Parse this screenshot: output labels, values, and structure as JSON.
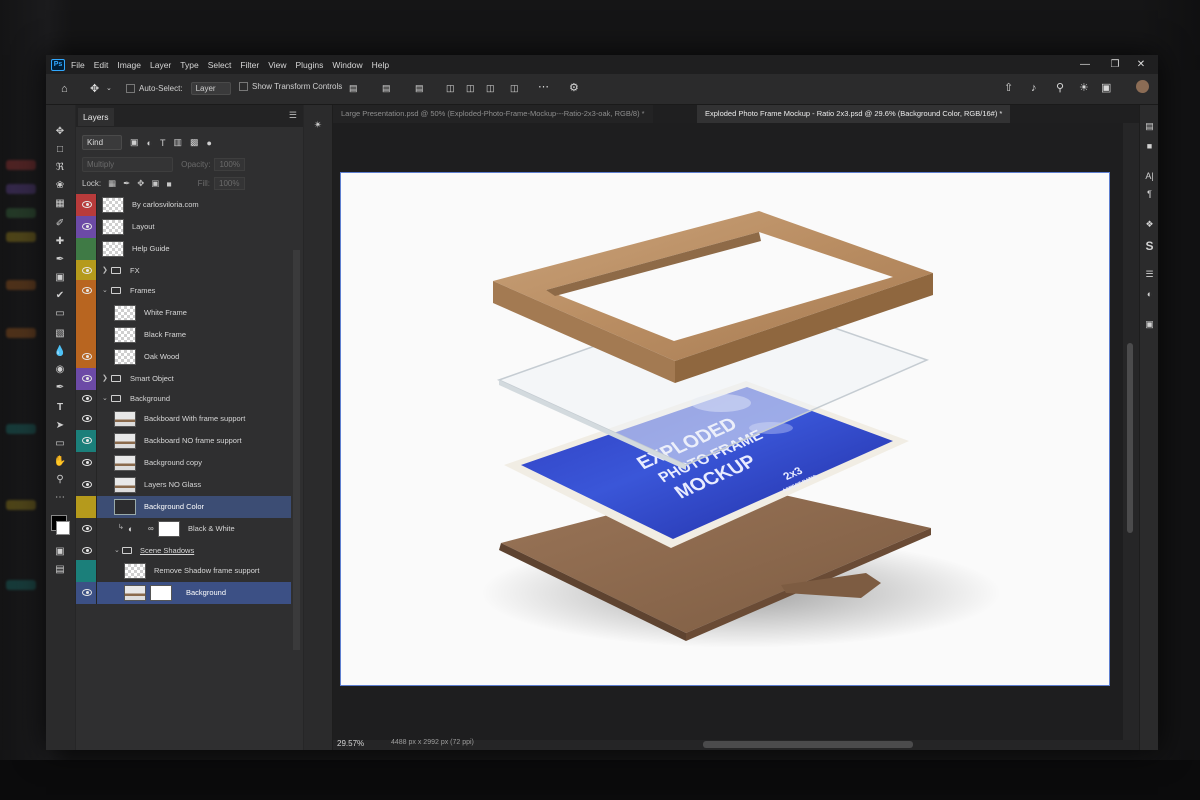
{
  "menu": [
    "File",
    "Edit",
    "Image",
    "Layer",
    "Type",
    "Select",
    "Filter",
    "View",
    "Plugins",
    "Window",
    "Help"
  ],
  "options": {
    "auto_select_label": "Auto-Select:",
    "auto_select_value": "Layer",
    "transform_label": "Show Transform Controls"
  },
  "layers_panel": {
    "tab_label": "Layers",
    "filter_kind": "Kind",
    "blend_mode": "Multiply",
    "opacity_label": "Opacity:",
    "opacity_value": "100%",
    "lock_label": "Lock:",
    "fill_label": "Fill:",
    "fill_value": "100%",
    "layers": [
      {
        "name": "By carlosviloria.com",
        "color": "#b83b3b",
        "visible": true
      },
      {
        "name": "Layout",
        "color": "#6c4aa6",
        "visible": true
      },
      {
        "name": "Help Guide",
        "color": "#3f7a45",
        "visible": false
      },
      {
        "name": "FX",
        "color": "#b59a1c",
        "visible": true
      },
      {
        "name": "Frames",
        "color": "#b86520",
        "visible": true
      },
      {
        "name": "White Frame",
        "color": "#b86520",
        "visible": false
      },
      {
        "name": "Black Frame",
        "color": "#b86520",
        "visible": false
      },
      {
        "name": "Oak Wood",
        "color": "#b86520",
        "visible": true
      },
      {
        "name": "Smart Object",
        "color": "#6c4aa6",
        "visible": true
      },
      {
        "name": "Background",
        "color": "#2f2f30",
        "visible": true
      },
      {
        "name": "Backboard With frame support",
        "color": "#2f2f30",
        "visible": true
      },
      {
        "name": "Backboard NO frame support",
        "color": "#1b7f7a",
        "visible": true
      },
      {
        "name": "Background copy",
        "color": "#2f2f30",
        "visible": true
      },
      {
        "name": "Layers NO Glass",
        "color": "#2f2f30",
        "visible": true
      },
      {
        "name": "Background Color",
        "color": "#b59a1c",
        "visible": false
      },
      {
        "name": "Black & White",
        "color": "#2f2f30",
        "visible": true
      },
      {
        "name": "Scene Shadows",
        "color": "#2f2f30",
        "visible": true
      },
      {
        "name": "Remove Shadow frame support",
        "color": "#1b7f7a",
        "visible": false
      },
      {
        "name": "Background",
        "color": "#2f2f30",
        "visible": true
      }
    ]
  },
  "tabs": [
    {
      "label": "Large Presentation.psd @ 50% (Exploded-Photo-Frame-Mockup---Ratio-2x3-oak, RGB/8) *",
      "active": false
    },
    {
      "label": "Exploded Photo Frame Mockup - Ratio 2x3.psd @ 29.6% (Background Color, RGB/16#) *",
      "active": true
    }
  ],
  "status": {
    "zoom": "29.57%",
    "doc_size": "4488 px x 2992 px (72 ppi)"
  },
  "mockup": {
    "line1": "EXPLODED",
    "line2": "PHOTO FRAME",
    "line3": "MOCKUP",
    "ratio": "2x3",
    "ratio_sub": "ASPECT RATIO"
  }
}
